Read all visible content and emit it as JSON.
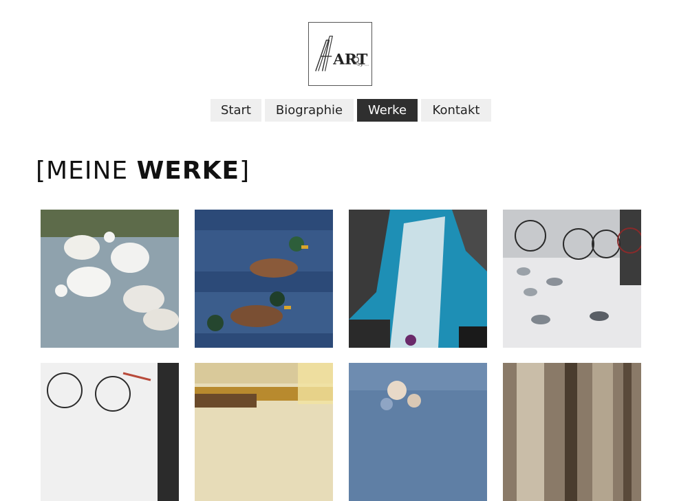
{
  "logo": {
    "text_main": "ART",
    "text_small": "by ..."
  },
  "nav": {
    "items": [
      {
        "label": "Start",
        "active": false
      },
      {
        "label": "Biographie",
        "active": false
      },
      {
        "label": "Werke",
        "active": true
      },
      {
        "label": "Kontakt",
        "active": false
      }
    ]
  },
  "page": {
    "heading_open": "[MEINE ",
    "heading_bold": "WERKE",
    "heading_close": "]"
  },
  "gallery": {
    "items": [
      {
        "subject": "white ducks in water",
        "colors": [
          "#5d6b4a",
          "#9fb0b5",
          "#f2f2f0"
        ]
      },
      {
        "subject": "mallard ducks on blue water",
        "colors": [
          "#2c4a78",
          "#4a6fa0",
          "#8a5a3a"
        ]
      },
      {
        "subject": "abstract blue and white",
        "colors": [
          "#1e8fb5",
          "#3a3a3a",
          "#e9eef0"
        ]
      },
      {
        "subject": "bicycles and pigeons",
        "colors": [
          "#e8e8ea",
          "#3b3b3b",
          "#9aa1a8"
        ]
      },
      {
        "subject": "bicycles",
        "colors": [
          "#f0f0f0",
          "#2b2b2b",
          "#b84a3a"
        ]
      },
      {
        "subject": "golden abstract landscape",
        "colors": [
          "#e7dcb8",
          "#b88a2e",
          "#6b4a2a"
        ]
      },
      {
        "subject": "blue floral still life",
        "colors": [
          "#5f7fa5",
          "#8fa5c4",
          "#e8d9c8"
        ]
      },
      {
        "subject": "brown abstract vertical strokes",
        "colors": [
          "#8a7a68",
          "#c9bda8",
          "#4a3c2e"
        ]
      }
    ]
  }
}
